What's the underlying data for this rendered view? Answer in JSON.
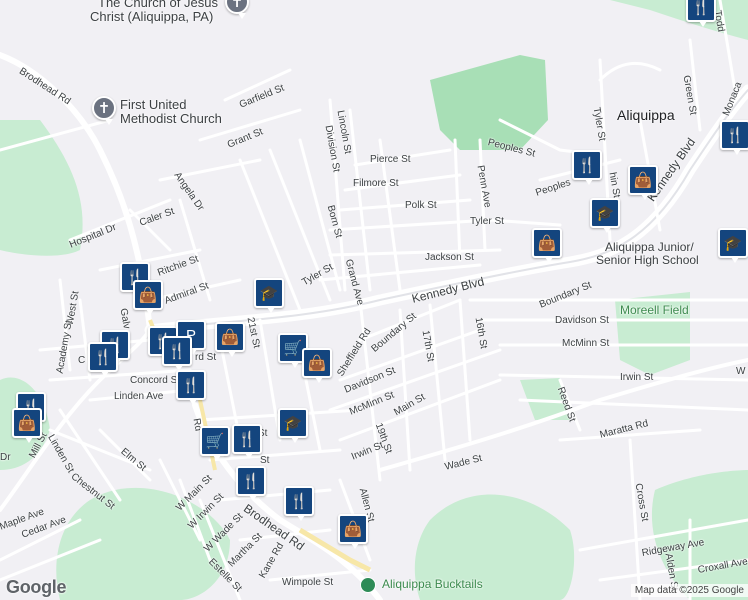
{
  "map": {
    "town": "Aliquippa",
    "places": {
      "church_jesus_1": "The Church of Jesus",
      "church_jesus_2": "Christ (Aliquippa, PA)",
      "methodist_1": "First United",
      "methodist_2": "Methodist Church",
      "school_1": "Aliquippa Junior/",
      "school_2": "Senior High School",
      "morell_field": "Moreell Field",
      "bucktails": "Aliquippa Bucktails"
    },
    "streets": {
      "brodhead_rd_top": "Brodhead Rd",
      "garfield": "Garfield St",
      "grant": "Grant St",
      "lincoln": "Lincoln St",
      "division": "Division St",
      "pierce": "Pierce St",
      "filmore": "Filmore St",
      "polk": "Polk St",
      "tyler_top": "Tyler St",
      "tyler_mid": "Tyler St",
      "jackson": "Jackson St",
      "kennedy_main": "Kennedy Blvd",
      "kennedy_right": "Kennedy Blvd",
      "peoples_1": "Peoples St",
      "peoples_2": "Peoples",
      "penn": "Penn Ave",
      "tyler_right": "Tyler St",
      "green": "Green St",
      "monaca": "Monaca",
      "todd": "Todd",
      "angela": "Angela Dr",
      "caler": "Caler St",
      "hospital": "Hospital Dr",
      "ritchie": "Ritchie St",
      "admiral": "Admiral St",
      "born": "Born St",
      "grand": "Grand Ave",
      "west": "West St",
      "academy": "Academy St",
      "twentyfirst": "21st St",
      "sheffield": "Sheffield Rd",
      "boundary_mid": "Boundary St",
      "boundary_right": "Boundary St",
      "seventeenth": "17th St",
      "sixteenth": "16th St",
      "davidson_mid": "Davidson St",
      "davidson_right": "Davidson St",
      "mcminn_mid": "McMinn St",
      "mcminn_right": "McMinn St",
      "main_st": "Main St",
      "nineteenth": "19th St",
      "irwin_mid": "Irwin St",
      "irwin_right": "Irwin St",
      "reed": "Reed St",
      "maratta": "Maratta Rd",
      "wade": "Wade St",
      "concord": "Concord St",
      "linden_ave": "Linden Ave",
      "linden_st": "Linden St",
      "elm": "Elm St",
      "chestnut": "Chestnut St",
      "mill": "Mill St",
      "maple": "Maple Ave",
      "cedar": "Cedar Ave",
      "w_main": "W Main St",
      "w_irwin": "W Irwin St",
      "w_wade": "W Wade St",
      "martha": "Martha St",
      "estelle": "Estelle St",
      "kane": "Kane Rd",
      "brodhead_bottom": "Brodhead Rd",
      "allen": "Allen St",
      "wimpole": "Wimpole St",
      "cross": "Cross St",
      "ridgeway": "Ridgeway Ave",
      "croxall": "Croxall Ave",
      "alden": "Alden St",
      "rd_partial": "Rd",
      "dr_partial": "Dr",
      "ford_partial": "rd St",
      "st_partial": "St",
      "galv_partial": "Galv",
      "c_partial": "C",
      "w_partial": "W",
      "st_partial2": "St",
      "hin_partial": "hin St"
    },
    "footer": {
      "logo": "Google",
      "credit": "Map data ©2025 Google"
    },
    "colors": {
      "background": "#f1f0f4",
      "park": "#c8ecd2",
      "park_dark": "#a8dfb6",
      "road": "#ffffff",
      "major_road": "#ffffff",
      "poi_marker": "#14457e"
    },
    "icons": {
      "restaurant": "fork-knife-icon",
      "shopping": "shopping-bag-icon",
      "school": "graduation-cap-icon",
      "grocery": "shopping-cart-icon",
      "church": "cross-icon",
      "parking": "parking-icon",
      "park_pin": "park-pin-icon"
    }
  }
}
